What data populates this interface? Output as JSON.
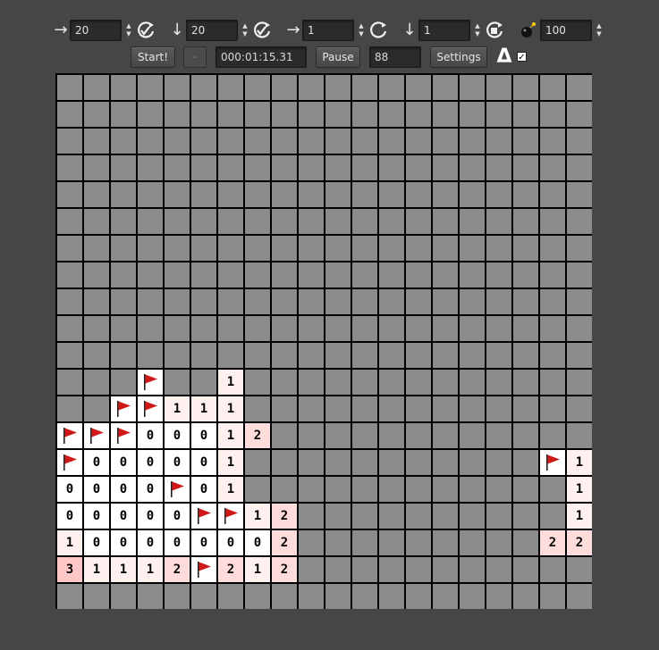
{
  "toolbar": {
    "width_value": "20",
    "height_value": "20",
    "shift_x_value": "1",
    "shift_y_value": "1",
    "mines_value": "100",
    "start_label": "Start!",
    "small_button_label": "-",
    "timer": "000:01:15.31",
    "pause_label": "Pause",
    "counter": "88",
    "settings_label": "Settings",
    "delta_label": "Δ",
    "delta_checked": true,
    "right_arrow": "→",
    "down_arrow": "↓",
    "icons": {
      "width": "arrow-right-icon",
      "height": "arrow-down-icon",
      "mode": "refresh-check-icon",
      "mine": "bomb-icon",
      "delta": "delta-icon"
    }
  },
  "colors": {
    "background": "#464646",
    "hidden_cell": "#8c8c8c",
    "open_cell": "#ffffff",
    "flag": "#d01818",
    "tint_1": "#fff0f0",
    "tint_2": "#ffdcdc",
    "tint_3": "#ffc8c8"
  },
  "board": {
    "rows": 20,
    "cols": 20,
    "legend": "H=hidden, F=flag, digit=revealed count",
    "cells": [
      [
        "H",
        "H",
        "H",
        "H",
        "H",
        "H",
        "H",
        "H",
        "H",
        "H",
        "H",
        "H",
        "H",
        "H",
        "H",
        "H",
        "H",
        "H",
        "H",
        "H"
      ],
      [
        "H",
        "H",
        "H",
        "H",
        "H",
        "H",
        "H",
        "H",
        "H",
        "H",
        "H",
        "H",
        "H",
        "H",
        "H",
        "H",
        "H",
        "H",
        "H",
        "H"
      ],
      [
        "H",
        "H",
        "H",
        "H",
        "H",
        "H",
        "H",
        "H",
        "H",
        "H",
        "H",
        "H",
        "H",
        "H",
        "H",
        "H",
        "H",
        "H",
        "H",
        "H"
      ],
      [
        "H",
        "H",
        "H",
        "H",
        "H",
        "H",
        "H",
        "H",
        "H",
        "H",
        "H",
        "H",
        "H",
        "H",
        "H",
        "H",
        "H",
        "H",
        "H",
        "H"
      ],
      [
        "H",
        "H",
        "H",
        "H",
        "H",
        "H",
        "H",
        "H",
        "H",
        "H",
        "H",
        "H",
        "H",
        "H",
        "H",
        "H",
        "H",
        "H",
        "H",
        "H"
      ],
      [
        "H",
        "H",
        "H",
        "H",
        "H",
        "H",
        "H",
        "H",
        "H",
        "H",
        "H",
        "H",
        "H",
        "H",
        "H",
        "H",
        "H",
        "H",
        "H",
        "H"
      ],
      [
        "H",
        "H",
        "H",
        "H",
        "H",
        "H",
        "H",
        "H",
        "H",
        "H",
        "H",
        "H",
        "H",
        "H",
        "H",
        "H",
        "H",
        "H",
        "H",
        "H"
      ],
      [
        "H",
        "H",
        "H",
        "H",
        "H",
        "H",
        "H",
        "H",
        "H",
        "H",
        "H",
        "H",
        "H",
        "H",
        "H",
        "H",
        "H",
        "H",
        "H",
        "H"
      ],
      [
        "H",
        "H",
        "H",
        "H",
        "H",
        "H",
        "H",
        "H",
        "H",
        "H",
        "H",
        "H",
        "H",
        "H",
        "H",
        "H",
        "H",
        "H",
        "H",
        "H"
      ],
      [
        "H",
        "H",
        "H",
        "H",
        "H",
        "H",
        "H",
        "H",
        "H",
        "H",
        "H",
        "H",
        "H",
        "H",
        "H",
        "H",
        "H",
        "H",
        "H",
        "H"
      ],
      [
        "H",
        "H",
        "H",
        "H",
        "H",
        "H",
        "H",
        "H",
        "H",
        "H",
        "H",
        "H",
        "H",
        "H",
        "H",
        "H",
        "H",
        "H",
        "H",
        "H"
      ],
      [
        "H",
        "H",
        "H",
        "F",
        "H",
        "H",
        "1",
        "H",
        "H",
        "H",
        "H",
        "H",
        "H",
        "H",
        "H",
        "H",
        "H",
        "H",
        "H",
        "H"
      ],
      [
        "H",
        "H",
        "F",
        "F",
        "1",
        "1",
        "1",
        "H",
        "H",
        "H",
        "H",
        "H",
        "H",
        "H",
        "H",
        "H",
        "H",
        "H",
        "H",
        "H"
      ],
      [
        "F",
        "F",
        "F",
        "0",
        "0",
        "0",
        "1",
        "2",
        "H",
        "H",
        "H",
        "H",
        "H",
        "H",
        "H",
        "H",
        "H",
        "H",
        "H",
        "H"
      ],
      [
        "F",
        "0",
        "0",
        "0",
        "0",
        "0",
        "1",
        "H",
        "H",
        "H",
        "H",
        "H",
        "H",
        "H",
        "H",
        "H",
        "H",
        "H",
        "F",
        "1"
      ],
      [
        "0",
        "0",
        "0",
        "0",
        "F",
        "0",
        "1",
        "H",
        "H",
        "H",
        "H",
        "H",
        "H",
        "H",
        "H",
        "H",
        "H",
        "H",
        "H",
        "1"
      ],
      [
        "0",
        "0",
        "0",
        "0",
        "0",
        "F",
        "F",
        "1",
        "2",
        "H",
        "H",
        "H",
        "H",
        "H",
        "H",
        "H",
        "H",
        "H",
        "H",
        "1"
      ],
      [
        "1",
        "0",
        "0",
        "0",
        "0",
        "0",
        "0",
        "0",
        "2",
        "H",
        "H",
        "H",
        "H",
        "H",
        "H",
        "H",
        "H",
        "H",
        "2",
        "2"
      ],
      [
        "3",
        "1",
        "1",
        "1",
        "2",
        "F",
        "2",
        "1",
        "2",
        "H",
        "H",
        "H",
        "H",
        "H",
        "H",
        "H",
        "H",
        "H",
        "H",
        "H"
      ],
      [
        "H",
        "H",
        "H",
        "H",
        "H",
        "H",
        "H",
        "H",
        "H",
        "H",
        "H",
        "H",
        "H",
        "H",
        "H",
        "H",
        "H",
        "H",
        "H",
        "H"
      ]
    ]
  }
}
